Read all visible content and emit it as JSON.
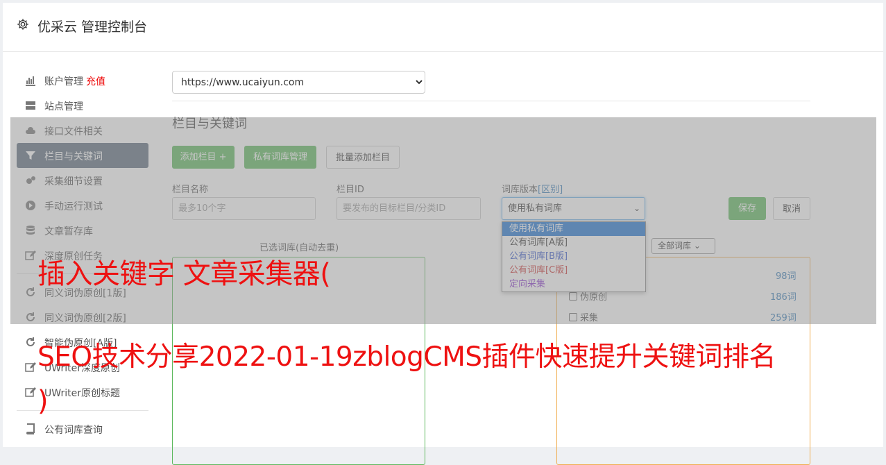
{
  "header": {
    "title": "优采云 管理控制台"
  },
  "sidebar": {
    "items": [
      {
        "label": "账户管理",
        "badge": "充值",
        "icon": "bar-chart-icon"
      },
      {
        "label": "站点管理",
        "icon": "server-icon"
      },
      {
        "label": "接口文件相关",
        "icon": "cloud-upload-icon"
      },
      {
        "label": "栏目与关键词",
        "icon": "filter-icon",
        "active": true
      },
      {
        "label": "采集细节设置",
        "icon": "cogs-icon"
      },
      {
        "label": "手动运行测试",
        "icon": "play-icon"
      },
      {
        "label": "文章暂存库",
        "icon": "database-icon"
      },
      {
        "label": "深度原创任务",
        "icon": "edit-icon"
      }
    ],
    "items2": [
      {
        "label": "同义词伪原创[1版]",
        "icon": "refresh-icon"
      },
      {
        "label": "同义词伪原创[2版]",
        "icon": "refresh-icon"
      },
      {
        "label": "智能伪原创[A版]",
        "icon": "refresh-icon"
      },
      {
        "label": "UWriter深度原创",
        "icon": "edit-icon"
      },
      {
        "label": "UWriter原创标题",
        "icon": "edit-icon"
      }
    ],
    "items3": [
      {
        "label": "公有词库查询",
        "icon": "book-icon"
      }
    ]
  },
  "main": {
    "site_select": "https://www.ucaiyun.com",
    "section_title": "栏目与关键词",
    "buttons": {
      "add_column": "添加栏目 +",
      "private_lib": "私有词库管理",
      "batch_add": "批量添加栏目"
    },
    "form": {
      "name_label": "栏目名称",
      "name_placeholder": "最多10个字",
      "id_label": "栏目ID",
      "id_placeholder": "要发布的目标栏目/分类ID",
      "lib_label": "词库版本",
      "lib_label_link": "[区别]",
      "lib_value": "使用私有词库",
      "save": "保存",
      "cancel": "取消"
    },
    "dropdown_options": [
      "使用私有词库",
      "公有词库[A版]",
      "公有词库[B版]",
      "公有词库[C版]",
      "定向采集"
    ],
    "dropdown_colors": [
      "#ffffff",
      "#333333",
      "#3355cc",
      "#cc3333",
      "#8833cc"
    ],
    "selected_title": "已选词库(自动去重)",
    "all_lib_select": "全部词库",
    "libs": [
      {
        "label": "",
        "count": "98词"
      },
      {
        "label": "伪原创",
        "count": "186词"
      },
      {
        "label": "采集",
        "count": "259词"
      }
    ]
  },
  "overlay_text": {
    "line1": "插入关键字 文章采集器(",
    "line2": "SEO技术分享2022-01-19zblogCMS插件快速提升关键词排名",
    "line3": ")"
  }
}
